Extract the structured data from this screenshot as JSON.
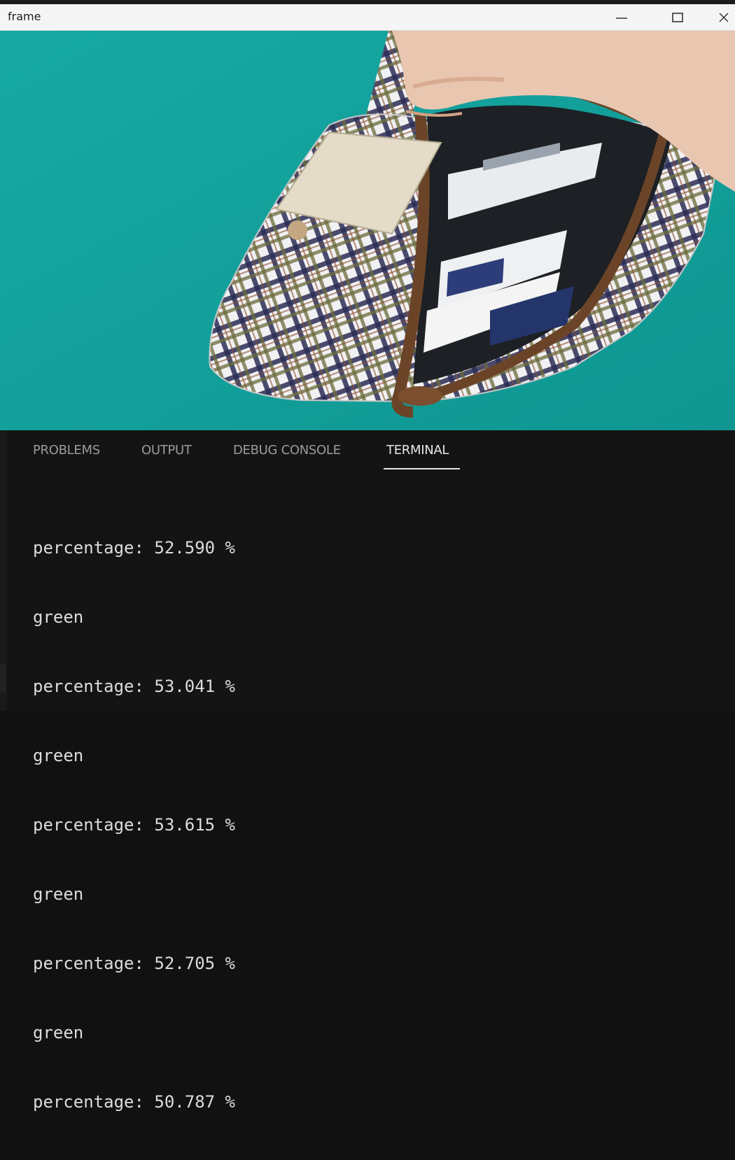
{
  "window": {
    "title": "frame",
    "minimize_symbol": "—",
    "maximize_symbol": "☐",
    "close_symbol": "✕"
  },
  "panel": {
    "tabs": [
      {
        "label": "PROBLEMS",
        "active": false
      },
      {
        "label": "OUTPUT",
        "active": false
      },
      {
        "label": "DEBUG CONSOLE",
        "active": false
      },
      {
        "label": "TERMINAL",
        "active": true
      }
    ],
    "terminal_lines": [
      "percentage: 52.590 %",
      "green",
      "percentage: 53.041 %",
      "green",
      "percentage: 53.615 %",
      "green",
      "percentage: 52.705 %",
      "green",
      "percentage: 50.787 %"
    ]
  },
  "colors": {
    "background_teal": "#14a19c",
    "terminal_bg": "#141414",
    "terminal_text": "#dcdcdc"
  }
}
